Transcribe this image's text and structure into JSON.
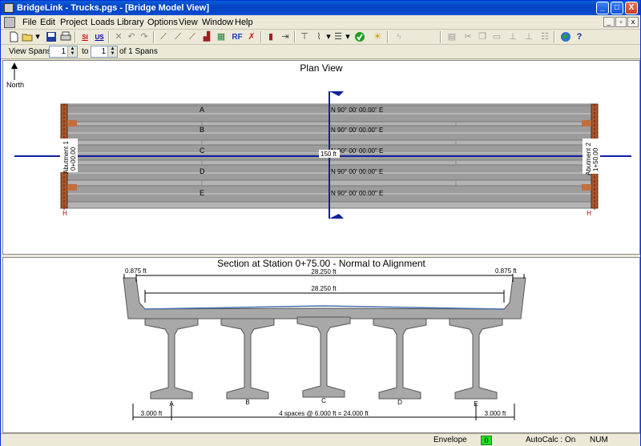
{
  "window": {
    "title": "BridgeLink - Trucks.pgs - [Bridge Model View]",
    "controls": {
      "minimize": "_",
      "maximize": "□",
      "close": "X"
    }
  },
  "menu": [
    "File",
    "Edit",
    "Project",
    "Loads",
    "Library",
    "Options",
    "View",
    "Window",
    "Help"
  ],
  "mdi_controls": {
    "minimize": "_",
    "restore": "▫",
    "close": "x"
  },
  "toolbar": {
    "new_icon": "new-document-icon",
    "open_icon": "open-folder-icon",
    "save_icon": "save-disk-icon",
    "print_icon": "printer-icon",
    "si_label": "SI",
    "us_label": "US",
    "rf_label": "RF"
  },
  "view_spans": {
    "label": "View Spans",
    "from": "1",
    "to_label": "to",
    "to": "1",
    "of_label": "of 1 Spans"
  },
  "plan_view": {
    "title": "Plan View",
    "north_label": "North",
    "girders": [
      "A",
      "B",
      "C",
      "D",
      "E"
    ],
    "bearing": "N 90° 00' 00.00\" E",
    "span_length": "150 ft",
    "abutment1": "Abutment 1",
    "station1": "0+00.00",
    "abutment2": "Abutment 2",
    "station2": "1+50.00",
    "pier_mark": "H"
  },
  "section_view": {
    "title": "Section at Station 0+75.00 - Normal to Alignment",
    "left_barrier": "0.875 ft",
    "right_barrier": "0.875 ft",
    "overall_width": "28.250 ft",
    "roadway_width": "28.250 ft",
    "girders": [
      "A",
      "B",
      "C",
      "D",
      "E"
    ],
    "left_overhang": "3.000 ft",
    "spacing": "4 spaces @ 6.000 ft = 24.000 ft",
    "right_overhang": "3.000 ft"
  },
  "status": {
    "mode": "Envelope",
    "indicator": "0",
    "autocalc": "AutoCalc : On",
    "num": "NUM"
  }
}
